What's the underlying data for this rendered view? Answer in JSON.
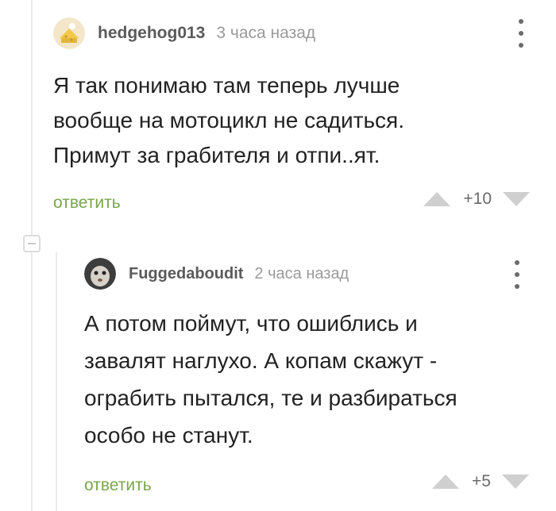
{
  "comments": [
    {
      "username": "hedgehog013",
      "time": "3 часа назад",
      "text": "Я так понимаю там теперь лучше\nвообще на мотоцикл не садиться.\nПримут за грабителя и отпи..ят.",
      "reply_label": "ответить",
      "rating": "+10"
    },
    {
      "username": "Fuggedaboudit",
      "time": "2 часа назад",
      "text": "А потом поймут, что ошиблись и\nзавалят наглухо. А копам скажут -\nограбить пытался, те и разбираться\nособо не станут.",
      "reply_label": "ответить",
      "rating": "+5"
    }
  ],
  "colors": {
    "reply": "#79a64b",
    "username": "#5a5a5a",
    "muted": "#9a9a9a"
  },
  "icons": [
    "more-vertical-icon",
    "vote-up-icon",
    "vote-down-icon",
    "collapse-thread-icon"
  ]
}
